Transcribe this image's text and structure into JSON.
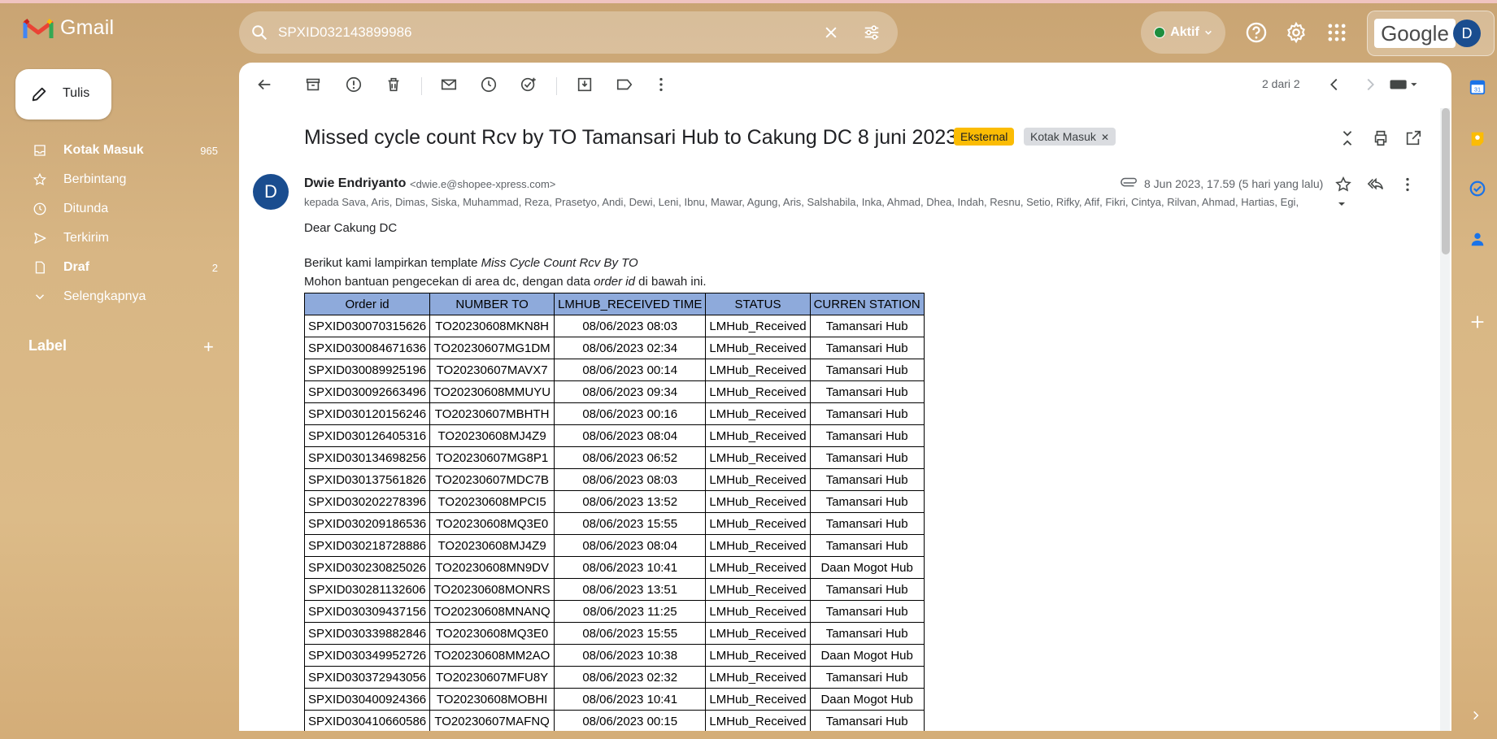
{
  "app": {
    "name": "Gmail"
  },
  "search": {
    "query": "SPXID032143899986"
  },
  "header": {
    "status_label": "Aktif",
    "google_label": "Google",
    "avatar_initial": "D"
  },
  "nav": {
    "compose_label": "Tulis",
    "items": [
      {
        "label": "Kotak Masuk",
        "count": "965",
        "icon": "inbox-icon",
        "bold": true
      },
      {
        "label": "Berbintang",
        "count": "",
        "icon": "star-icon",
        "bold": false
      },
      {
        "label": "Ditunda",
        "count": "",
        "icon": "clock-icon",
        "bold": false
      },
      {
        "label": "Terkirim",
        "count": "",
        "icon": "send-icon",
        "bold": false
      },
      {
        "label": "Draf",
        "count": "2",
        "icon": "draft-icon",
        "bold": true
      },
      {
        "label": "Selengkapnya",
        "count": "",
        "icon": "chevron-down-icon",
        "bold": false
      }
    ],
    "label_heading": "Label"
  },
  "toolbar": {
    "pager": "2 dari 2"
  },
  "email": {
    "subject": "Missed cycle count Rcv by TO Tamansari Hub to Cakung DC 8 juni 2023",
    "chips": {
      "external": "Eksternal",
      "inbox": "Kotak Masuk"
    },
    "sender_initial": "D",
    "sender_name": "Dwie Endriyanto",
    "sender_email": "<dwie.e@shopee-xpress.com>",
    "date": "8 Jun 2023, 17.59 (5 hari yang lalu)",
    "recipients": "kepada Sava, Aris, Dimas, Siska, Muhammad, Reza, Prasetyo, Andi, Dewi, Leni, Ibnu, Mawar, Agung, Aris, Salshabila, Inka, Ahmad, Dhea, Indah, Resnu, Setio, Rifky, Afif, Fikri, Cintya, Rilvan, Ahmad, Hartias, Egi,",
    "greeting": "Dear Cakung DC",
    "line1_prefix": "Berikut kami lampirkan template ",
    "line1_italic": "Miss Cycle Count Rcv By TO",
    "line2_prefix": "Mohon bantuan pengecekan di area dc, dengan data ",
    "line2_italic": "order id",
    "line2_suffix": " di bawah ini.",
    "table": {
      "headers": [
        "Order id",
        "NUMBER TO",
        "LMHUB_RECEIVED TIME",
        "STATUS",
        "CURREN STATION"
      ],
      "rows": [
        [
          "SPXID030070315626",
          "TO20230608MKN8H",
          "08/06/2023 08:03",
          "LMHub_Received",
          "Tamansari Hub"
        ],
        [
          "SPXID030084671636",
          "TO20230607MG1DM",
          "08/06/2023 02:34",
          "LMHub_Received",
          "Tamansari Hub"
        ],
        [
          "SPXID030089925196",
          "TO20230607MAVX7",
          "08/06/2023 00:14",
          "LMHub_Received",
          "Tamansari Hub"
        ],
        [
          "SPXID030092663496",
          "TO20230608MMUYU",
          "08/06/2023 09:34",
          "LMHub_Received",
          "Tamansari Hub"
        ],
        [
          "SPXID030120156246",
          "TO20230607MBHTH",
          "08/06/2023 00:16",
          "LMHub_Received",
          "Tamansari Hub"
        ],
        [
          "SPXID030126405316",
          "TO20230608MJ4Z9",
          "08/06/2023 08:04",
          "LMHub_Received",
          "Tamansari Hub"
        ],
        [
          "SPXID030134698256",
          "TO20230607MG8P1",
          "08/06/2023 06:52",
          "LMHub_Received",
          "Tamansari Hub"
        ],
        [
          "SPXID030137561826",
          "TO20230607MDC7B",
          "08/06/2023 08:03",
          "LMHub_Received",
          "Tamansari Hub"
        ],
        [
          "SPXID030202278396",
          "TO20230608MPCI5",
          "08/06/2023 13:52",
          "LMHub_Received",
          "Tamansari Hub"
        ],
        [
          "SPXID030209186536",
          "TO20230608MQ3E0",
          "08/06/2023 15:55",
          "LMHub_Received",
          "Tamansari Hub"
        ],
        [
          "SPXID030218728886",
          "TO20230608MJ4Z9",
          "08/06/2023 08:04",
          "LMHub_Received",
          "Tamansari Hub"
        ],
        [
          "SPXID030230825026",
          "TO20230608MN9DV",
          "08/06/2023 10:41",
          "LMHub_Received",
          "Daan Mogot Hub"
        ],
        [
          "SPXID030281132606",
          "TO20230608MONRS",
          "08/06/2023 13:51",
          "LMHub_Received",
          "Tamansari Hub"
        ],
        [
          "SPXID030309437156",
          "TO20230608MNANQ",
          "08/06/2023 11:25",
          "LMHub_Received",
          "Tamansari Hub"
        ],
        [
          "SPXID030339882846",
          "TO20230608MQ3E0",
          "08/06/2023 15:55",
          "LMHub_Received",
          "Tamansari Hub"
        ],
        [
          "SPXID030349952726",
          "TO20230608MM2AO",
          "08/06/2023 10:38",
          "LMHub_Received",
          "Daan Mogot Hub"
        ],
        [
          "SPXID030372943056",
          "TO20230607MFU8Y",
          "08/06/2023 02:32",
          "LMHub_Received",
          "Tamansari Hub"
        ],
        [
          "SPXID030400924366",
          "TO20230608MOBHI",
          "08/06/2023 10:41",
          "LMHub_Received",
          "Daan Mogot Hub"
        ],
        [
          "SPXID030410660586",
          "TO20230607MAFNQ",
          "08/06/2023 00:15",
          "LMHub_Received",
          "Tamansari Hub"
        ]
      ]
    }
  }
}
